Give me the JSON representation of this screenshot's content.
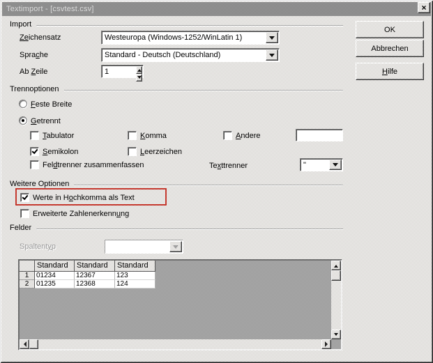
{
  "window": {
    "title": "Textimport - [csvtest.csv]",
    "close_glyph": "×"
  },
  "buttons": {
    "ok": "OK",
    "cancel": "Abbrechen",
    "help": {
      "pre": "",
      "key": "H",
      "post": "ilfe"
    }
  },
  "import": {
    "section": "Import",
    "charset_label": {
      "pre": "",
      "key": "Ze",
      "post": "ichensatz"
    },
    "charset_value": "Westeuropa (Windows-1252/WinLatin 1)",
    "language_label": {
      "pre": "Spra",
      "key": "c",
      "post": "he"
    },
    "language_value": "Standard - Deutsch (Deutschland)",
    "from_row_label": {
      "pre": "Ab ",
      "key": "Z",
      "post": "eile"
    },
    "from_row_value": "1"
  },
  "separator": {
    "section": "Trennoptionen",
    "fixed_width": {
      "pre": "",
      "key": "F",
      "post": "este Breite"
    },
    "separated": {
      "pre": "",
      "key": "G",
      "post": "etrennt"
    },
    "tab": {
      "pre": "",
      "key": "T",
      "post": "abulator"
    },
    "comma": {
      "pre": "",
      "key": "K",
      "post": "omma"
    },
    "other": {
      "pre": "",
      "key": "A",
      "post": "ndere"
    },
    "other_value": "",
    "semicolon": {
      "pre": "",
      "key": "S",
      "post": "emikolon"
    },
    "space": {
      "pre": "",
      "key": "L",
      "post": "eerzeichen"
    },
    "merge_delimiters": {
      "pre": "Fel",
      "key": "d",
      "post": "trenner zusammenfassen"
    },
    "text_delimiter_label": {
      "pre": "Te",
      "key": "x",
      "post": "ttrenner"
    },
    "text_delimiter_value": "\""
  },
  "other_options": {
    "section": "Weitere Optionen",
    "quoted_as_text": {
      "pre": "Werte in H",
      "key": "o",
      "post": "chkomma als Text"
    },
    "detect_numbers": {
      "pre": "Erweiterte Zahlenerkenn",
      "key": "u",
      "post": "ng"
    }
  },
  "fields": {
    "section": "Felder",
    "column_type_label": {
      "pre": "Spaltent",
      "key": "y",
      "post": "p"
    },
    "column_type_value": "",
    "table": {
      "headers": [
        "Standard",
        "Standard",
        "Standard"
      ],
      "rows": [
        {
          "num": "1",
          "cells": [
            "01234",
            "12367",
            "123"
          ]
        },
        {
          "num": "2",
          "cells": [
            "01235",
            "12368",
            "124"
          ]
        }
      ]
    }
  },
  "states": {
    "fixed_width": false,
    "separated": true,
    "tab": false,
    "comma": false,
    "other": false,
    "semicolon": true,
    "space": false,
    "merge_delimiters": false,
    "quoted_as_text": true,
    "detect_numbers": false
  },
  "colors": {
    "annotation_red": "#c5392f"
  }
}
